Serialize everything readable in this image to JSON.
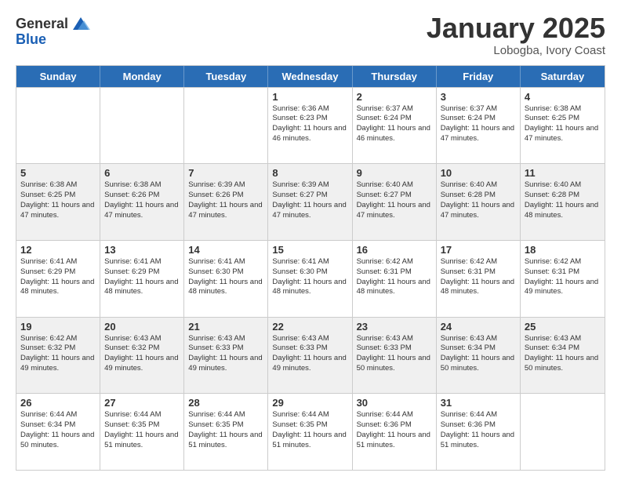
{
  "header": {
    "logo_line1": "General",
    "logo_line2": "Blue",
    "title": "January 2025",
    "location": "Lobogba, Ivory Coast"
  },
  "weekdays": [
    "Sunday",
    "Monday",
    "Tuesday",
    "Wednesday",
    "Thursday",
    "Friday",
    "Saturday"
  ],
  "rows": [
    [
      {
        "day": "",
        "info": "",
        "shaded": false
      },
      {
        "day": "",
        "info": "",
        "shaded": false
      },
      {
        "day": "",
        "info": "",
        "shaded": false
      },
      {
        "day": "1",
        "info": "Sunrise: 6:36 AM\nSunset: 6:23 PM\nDaylight: 11 hours\nand 46 minutes.",
        "shaded": false
      },
      {
        "day": "2",
        "info": "Sunrise: 6:37 AM\nSunset: 6:24 PM\nDaylight: 11 hours\nand 46 minutes.",
        "shaded": false
      },
      {
        "day": "3",
        "info": "Sunrise: 6:37 AM\nSunset: 6:24 PM\nDaylight: 11 hours\nand 47 minutes.",
        "shaded": false
      },
      {
        "day": "4",
        "info": "Sunrise: 6:38 AM\nSunset: 6:25 PM\nDaylight: 11 hours\nand 47 minutes.",
        "shaded": false
      }
    ],
    [
      {
        "day": "5",
        "info": "Sunrise: 6:38 AM\nSunset: 6:25 PM\nDaylight: 11 hours\nand 47 minutes.",
        "shaded": true
      },
      {
        "day": "6",
        "info": "Sunrise: 6:38 AM\nSunset: 6:26 PM\nDaylight: 11 hours\nand 47 minutes.",
        "shaded": true
      },
      {
        "day": "7",
        "info": "Sunrise: 6:39 AM\nSunset: 6:26 PM\nDaylight: 11 hours\nand 47 minutes.",
        "shaded": true
      },
      {
        "day": "8",
        "info": "Sunrise: 6:39 AM\nSunset: 6:27 PM\nDaylight: 11 hours\nand 47 minutes.",
        "shaded": true
      },
      {
        "day": "9",
        "info": "Sunrise: 6:40 AM\nSunset: 6:27 PM\nDaylight: 11 hours\nand 47 minutes.",
        "shaded": true
      },
      {
        "day": "10",
        "info": "Sunrise: 6:40 AM\nSunset: 6:28 PM\nDaylight: 11 hours\nand 47 minutes.",
        "shaded": true
      },
      {
        "day": "11",
        "info": "Sunrise: 6:40 AM\nSunset: 6:28 PM\nDaylight: 11 hours\nand 48 minutes.",
        "shaded": true
      }
    ],
    [
      {
        "day": "12",
        "info": "Sunrise: 6:41 AM\nSunset: 6:29 PM\nDaylight: 11 hours\nand 48 minutes.",
        "shaded": false
      },
      {
        "day": "13",
        "info": "Sunrise: 6:41 AM\nSunset: 6:29 PM\nDaylight: 11 hours\nand 48 minutes.",
        "shaded": false
      },
      {
        "day": "14",
        "info": "Sunrise: 6:41 AM\nSunset: 6:30 PM\nDaylight: 11 hours\nand 48 minutes.",
        "shaded": false
      },
      {
        "day": "15",
        "info": "Sunrise: 6:41 AM\nSunset: 6:30 PM\nDaylight: 11 hours\nand 48 minutes.",
        "shaded": false
      },
      {
        "day": "16",
        "info": "Sunrise: 6:42 AM\nSunset: 6:31 PM\nDaylight: 11 hours\nand 48 minutes.",
        "shaded": false
      },
      {
        "day": "17",
        "info": "Sunrise: 6:42 AM\nSunset: 6:31 PM\nDaylight: 11 hours\nand 48 minutes.",
        "shaded": false
      },
      {
        "day": "18",
        "info": "Sunrise: 6:42 AM\nSunset: 6:31 PM\nDaylight: 11 hours\nand 49 minutes.",
        "shaded": false
      }
    ],
    [
      {
        "day": "19",
        "info": "Sunrise: 6:42 AM\nSunset: 6:32 PM\nDaylight: 11 hours\nand 49 minutes.",
        "shaded": true
      },
      {
        "day": "20",
        "info": "Sunrise: 6:43 AM\nSunset: 6:32 PM\nDaylight: 11 hours\nand 49 minutes.",
        "shaded": true
      },
      {
        "day": "21",
        "info": "Sunrise: 6:43 AM\nSunset: 6:33 PM\nDaylight: 11 hours\nand 49 minutes.",
        "shaded": true
      },
      {
        "day": "22",
        "info": "Sunrise: 6:43 AM\nSunset: 6:33 PM\nDaylight: 11 hours\nand 49 minutes.",
        "shaded": true
      },
      {
        "day": "23",
        "info": "Sunrise: 6:43 AM\nSunset: 6:33 PM\nDaylight: 11 hours\nand 50 minutes.",
        "shaded": true
      },
      {
        "day": "24",
        "info": "Sunrise: 6:43 AM\nSunset: 6:34 PM\nDaylight: 11 hours\nand 50 minutes.",
        "shaded": true
      },
      {
        "day": "25",
        "info": "Sunrise: 6:43 AM\nSunset: 6:34 PM\nDaylight: 11 hours\nand 50 minutes.",
        "shaded": true
      }
    ],
    [
      {
        "day": "26",
        "info": "Sunrise: 6:44 AM\nSunset: 6:34 PM\nDaylight: 11 hours\nand 50 minutes.",
        "shaded": false
      },
      {
        "day": "27",
        "info": "Sunrise: 6:44 AM\nSunset: 6:35 PM\nDaylight: 11 hours\nand 51 minutes.",
        "shaded": false
      },
      {
        "day": "28",
        "info": "Sunrise: 6:44 AM\nSunset: 6:35 PM\nDaylight: 11 hours\nand 51 minutes.",
        "shaded": false
      },
      {
        "day": "29",
        "info": "Sunrise: 6:44 AM\nSunset: 6:35 PM\nDaylight: 11 hours\nand 51 minutes.",
        "shaded": false
      },
      {
        "day": "30",
        "info": "Sunrise: 6:44 AM\nSunset: 6:36 PM\nDaylight: 11 hours\nand 51 minutes.",
        "shaded": false
      },
      {
        "day": "31",
        "info": "Sunrise: 6:44 AM\nSunset: 6:36 PM\nDaylight: 11 hours\nand 51 minutes.",
        "shaded": false
      },
      {
        "day": "",
        "info": "",
        "shaded": false
      }
    ]
  ]
}
